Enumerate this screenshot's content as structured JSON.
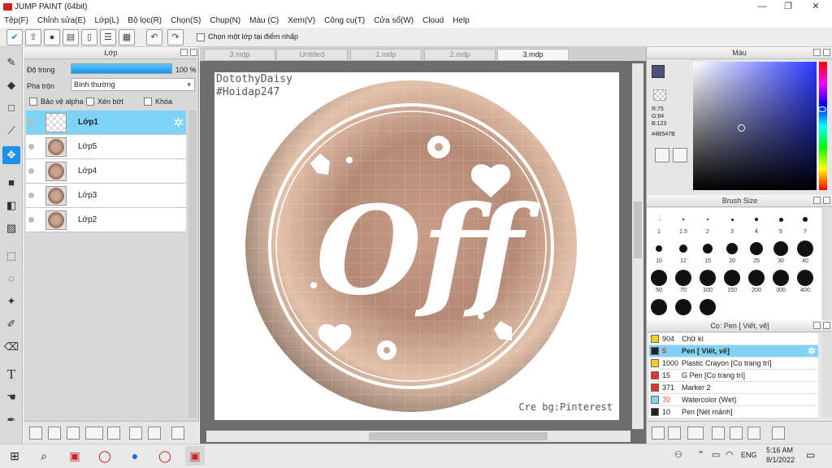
{
  "window": {
    "title": "JUMP PAINT (64bit)",
    "min": "—",
    "max": "❐",
    "close": "✕"
  },
  "menu": [
    "Tệp(F)",
    "Chỉnh sửa(E)",
    "Lớp(L)",
    "Bộ lọc(R)",
    "Chọn(S)",
    "Chụp(N)",
    "Màu (C)",
    "Xem(V)",
    "Công cụ(T)",
    "Cửa sổ(W)",
    "Cloud",
    "Help"
  ],
  "toolbar": {
    "select_layer_label": "Chọn một lớp tại điểm nhấp"
  },
  "layer_panel": {
    "title": "Lớp",
    "opacity_label": "Độ trong",
    "opacity_value": "100 %",
    "opacity_fraction": 1.0,
    "blend_label": "Pha trộn",
    "blend_value": "Bình thường",
    "protect_alpha": "Bảo vệ alpha",
    "clipping": "Xén bớt",
    "lock": "Khóa",
    "layers": [
      {
        "name": "Lớp1",
        "selected": true,
        "blank": true
      },
      {
        "name": "Lớp5"
      },
      {
        "name": "Lớp4"
      },
      {
        "name": "Lớp3"
      },
      {
        "name": "Lớp2"
      }
    ]
  },
  "tabs": [
    {
      "label": "3.mdp"
    },
    {
      "label": "Untitled"
    },
    {
      "label": "1.mdp"
    },
    {
      "label": "2.mdp"
    },
    {
      "label": "3.mdp",
      "active": true
    }
  ],
  "canvas": {
    "watermark_top": "DotothyDaisy",
    "watermark_hashtag": "#Hoidap247",
    "logo_text": "Off",
    "credit": "Cre bg:Pinterest"
  },
  "color_panel": {
    "title": "Màu",
    "r": "R:75",
    "g": "G:84",
    "b": "B:123",
    "hex": "#4B547B",
    "current_color": "#4B547B"
  },
  "brush_panel": {
    "title": "Brush Size",
    "sizes": [
      "1",
      "1.5",
      "2",
      "3",
      "4",
      "5",
      "7",
      "10",
      "12",
      "15",
      "20",
      "25",
      "30",
      "40",
      "50",
      "70",
      "100",
      "150",
      "200",
      "300",
      "400",
      "",
      "",
      ""
    ]
  },
  "pen_panel": {
    "title": "Cọ: Pen [ Viết, vẽ]",
    "items": [
      {
        "num": "904",
        "name": "Chữ kí",
        "color": "#f2d21b"
      },
      {
        "num": "5",
        "name": "Pen [ Viết, vẽ]",
        "color": "#222222",
        "selected": true
      },
      {
        "num": "1000",
        "name": "Plastic Crayon [Cọ trang trí]",
        "color": "#f2d21b"
      },
      {
        "num": "15",
        "name": "G Pen [Cọ trang trí]",
        "color": "#e23232"
      },
      {
        "num": "371",
        "name": "Marker 2",
        "color": "#e23232"
      },
      {
        "num": "70",
        "name": "Watercolor (Wet)",
        "color": "#7fd6f0"
      },
      {
        "num": "10",
        "name": "Pen [Nét mảnh]",
        "color": "#222222"
      }
    ]
  },
  "taskbar": {
    "lang": "ENG",
    "time": "5:16 AM",
    "date": "8/1/2022"
  },
  "icons": {
    "accent": "#1e90e8"
  }
}
